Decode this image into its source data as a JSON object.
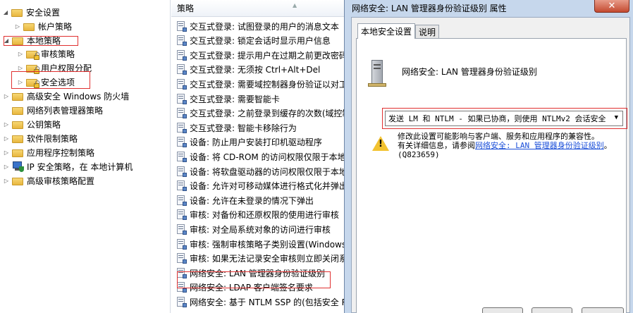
{
  "tree": {
    "items": [
      {
        "label": "安全设置",
        "toggle": "◢",
        "icon": "folder-icon"
      },
      {
        "label": "帐户策略",
        "toggle": "▷",
        "icon": "folder-icon"
      },
      {
        "label": "本地策略",
        "toggle": "◢",
        "icon": "folder-icon"
      },
      {
        "label": "审核策略",
        "toggle": "▷",
        "icon": "lock-folder-icon"
      },
      {
        "label": "用户权限分配",
        "toggle": "▷",
        "icon": "lock-folder-icon"
      },
      {
        "label": "安全选项",
        "toggle": "▷",
        "icon": "lock-folder-icon"
      },
      {
        "label": "高级安全 Windows 防火墙",
        "toggle": "▷",
        "icon": "folder-icon"
      },
      {
        "label": "网络列表管理器策略",
        "toggle": "",
        "icon": "folder-icon"
      },
      {
        "label": "公钥策略",
        "toggle": "▷",
        "icon": "folder-icon"
      },
      {
        "label": "软件限制策略",
        "toggle": "▷",
        "icon": "folder-icon"
      },
      {
        "label": "应用程序控制策略",
        "toggle": "▷",
        "icon": "folder-icon"
      },
      {
        "label": "IP 安全策略，在 本地计算机",
        "toggle": "▷",
        "icon": "ip-security-icon"
      },
      {
        "label": "高级审核策略配置",
        "toggle": "▷",
        "icon": "folder-icon"
      }
    ]
  },
  "list": {
    "header": "策略",
    "rows": [
      "交互式登录: 试图登录的用户的消息文本",
      "交互式登录: 锁定会话时显示用户信息",
      "交互式登录: 提示用户在过期之前更改密码",
      "交互式登录: 无须按 Ctrl+Alt+Del",
      "交互式登录: 需要域控制器身份验证以对工",
      "交互式登录: 需要智能卡",
      "交互式登录: 之前登录到缓存的次数(域控制",
      "交互式登录: 智能卡移除行为",
      "设备: 防止用户安装打印机驱动程序",
      "设备: 将 CD-ROM 的访问权限仅限于本地",
      "设备: 将软盘驱动器的访问权限仅限于本地",
      "设备: 允许对可移动媒体进行格式化并弹出",
      "设备: 允许在未登录的情况下弹出",
      "审核: 对备份和还原权限的使用进行审核",
      "审核: 对全局系统对象的访问进行审核",
      "审核: 强制审核策略子类别设置(Windows",
      "审核: 如果无法记录安全审核则立即关闭系",
      "网络安全: LAN 管理器身份验证级别",
      "网络安全: LDAP 客户端签名要求",
      "网络安全: 基于 NTLM SSP 的(包括安全 RI"
    ]
  },
  "dialog": {
    "title": "网络安全: LAN 管理器身份验证级别 属性",
    "close": "✕",
    "tabs": [
      "本地安全设置",
      "说明"
    ],
    "policy_name": "网络安全: LAN 管理器身份验证级别",
    "select_value": "发送 LM 和 NTLM - 如果已协商，则使用 NTLMv2 会话安全",
    "warning_line1": "修改此设置可能影响与客户端、服务和应用程序的兼容性。",
    "warning_line2_prefix": "有关详细信息，请参阅",
    "warning_link": "网络安全: LAN 管理器身份验证级别",
    "warning_line2_suffix": "。",
    "warning_line3": "(Q823659)"
  }
}
